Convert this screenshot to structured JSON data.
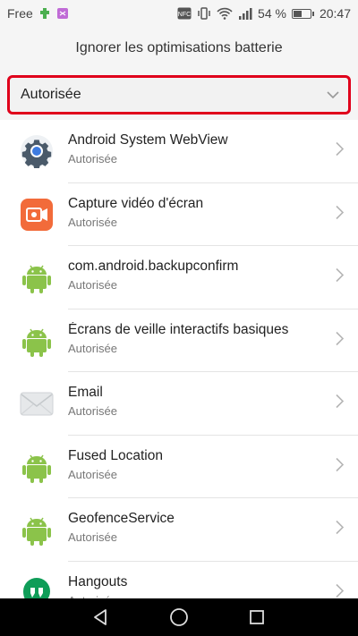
{
  "status_bar": {
    "carrier": "Free",
    "nfc_label": "NFC",
    "battery_percent_text": "54 %",
    "battery_level": 0.54,
    "time": "20:47"
  },
  "header": {
    "title": "Ignorer les optimisations batterie"
  },
  "filter": {
    "selected": "Autorisée",
    "highlight_color": "#e0001b"
  },
  "apps": [
    {
      "title": "Android System WebView",
      "status": "Autorisée",
      "icon": "webview-gear-icon"
    },
    {
      "title": "Capture vidéo d'écran",
      "status": "Autorisée",
      "icon": "screen-recorder-icon"
    },
    {
      "title": "com.android.backupconfirm",
      "status": "Autorisée",
      "icon": "android-robot-icon"
    },
    {
      "title": "Écrans de veille interactifs basiques",
      "status": "Autorisée",
      "icon": "android-robot-icon"
    },
    {
      "title": "Email",
      "status": "Autorisée",
      "icon": "email-envelope-icon"
    },
    {
      "title": "Fused Location",
      "status": "Autorisée",
      "icon": "android-robot-icon"
    },
    {
      "title": "GeofenceService",
      "status": "Autorisée",
      "icon": "android-robot-icon"
    },
    {
      "title": "Hangouts",
      "status": "Autorisée",
      "icon": "hangouts-icon"
    }
  ],
  "colors": {
    "android_green": "#8bc34a",
    "recorder_orange": "#f26b3a",
    "hangouts_green": "#0f9d58"
  }
}
